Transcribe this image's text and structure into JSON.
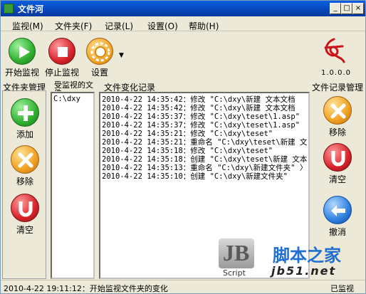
{
  "window": {
    "title": "文件河"
  },
  "title_buttons": {
    "minimize": "_",
    "maximize": "□",
    "close": "×"
  },
  "menu": [
    {
      "label": "监视(M)"
    },
    {
      "label": "文件夹(F)"
    },
    {
      "label": "记录(L)"
    },
    {
      "label": "设置(O)"
    },
    {
      "label": "帮助(H)"
    }
  ],
  "toolbar": {
    "start": "开始监视",
    "stop": "停止监视",
    "settings": "设置",
    "version": "1.0.0.0"
  },
  "panels": {
    "folder_manage": "文件夹管理",
    "watched": "受监视的文件",
    "changes": "文件变化记录",
    "log_manage": "文件记录管理"
  },
  "left_buttons": {
    "add": "添加",
    "remove": "移除",
    "clear": "清空"
  },
  "right_buttons": {
    "remove": "移除",
    "clear": "清空",
    "undo": "撤消"
  },
  "watched_items": [
    "C:\\dxy"
  ],
  "log_lines": [
    "2010-4-22 14:35:42：修改 \"C:\\dxy\\新建 文本文档",
    "2010-4-22 14:35:42：修改 \"C:\\dxy\\新建 文本文档",
    "2010-4-22 14:35:37：修改 \"C:\\dxy\\teset\\1.asp\"",
    "2010-4-22 14:35:37：修改 \"C:\\dxy\\teset\\1.asp\"",
    "2010-4-22 14:35:21：修改 \"C:\\dxy\\teset\"",
    "2010-4-22 14:35:21：重命名 \"C:\\dxy\\teset\\新建 文",
    "2010-4-22 14:35:18：修改 \"C:\\dxy\\teset\"",
    "2010-4-22 14:35:18：创建 \"C:\\dxy\\teset\\新建 文本",
    "2010-4-22 14:35:13：重命名 \"C:\\dxy\\新建文件夹\" 〉",
    "2010-4-22 14:35:10：创建 \"C:\\dxy\\新建文件夹\""
  ],
  "status": {
    "left": "2010-4-22 19:11:12：开始监视文件夹的变化",
    "right": "已监视"
  },
  "watermark": {
    "brand": "脚本之家",
    "domain": "jb51.net",
    "tag": "Script"
  },
  "colors": {
    "green": "#2fb02f",
    "red": "#d7222a",
    "orange": "#f0a020",
    "blue": "#2f7fe0"
  }
}
